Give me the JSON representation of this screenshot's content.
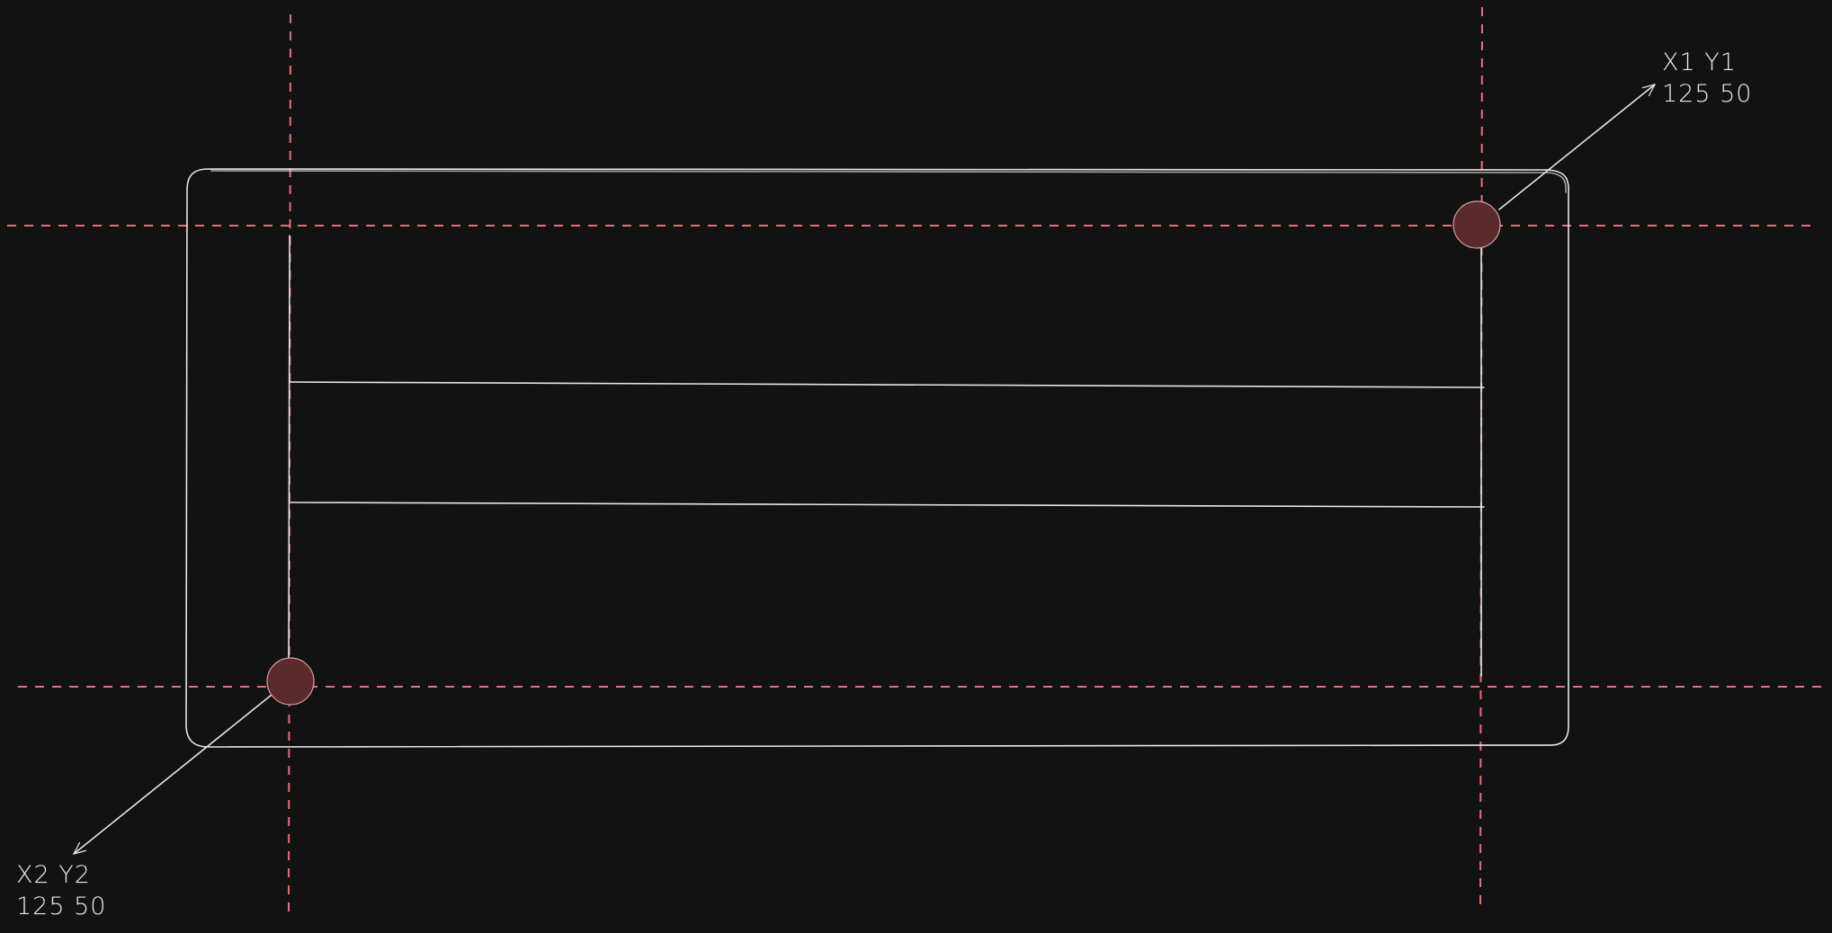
{
  "colors": {
    "background": "#121212",
    "stroke": "#e6e6e6",
    "guide": "#e5707a",
    "handle_fill": "#5a2a2c"
  },
  "annotations": {
    "top_right": {
      "labels": "X1 Y1",
      "values": "125 50"
    },
    "bottom_left": {
      "labels": "X2 Y2",
      "values": "125 50"
    }
  },
  "icons": [
    "arrow-icon",
    "handle-dot-icon"
  ]
}
